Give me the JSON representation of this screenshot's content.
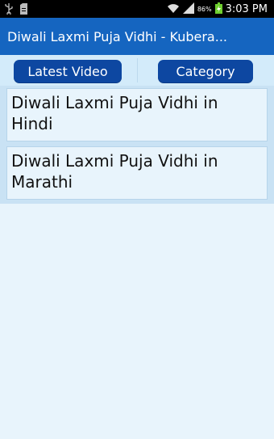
{
  "status_bar": {
    "time": "3:03 PM",
    "battery_percent": "86%",
    "icons": [
      "usb-icon",
      "sd-card-icon",
      "wifi-icon",
      "signal-icon",
      "battery-icon"
    ]
  },
  "app": {
    "title": "Diwali Laxmi Puja Vidhi - Kubera...",
    "accent_color": "#1565c0",
    "button_color": "#0d47a1"
  },
  "tabs": [
    {
      "label": "Latest Video"
    },
    {
      "label": "Category"
    }
  ],
  "list": {
    "items": [
      {
        "label": "Diwali Laxmi Puja Vidhi in Hindi"
      },
      {
        "label": "Diwali Laxmi Puja Vidhi in Marathi"
      }
    ]
  }
}
